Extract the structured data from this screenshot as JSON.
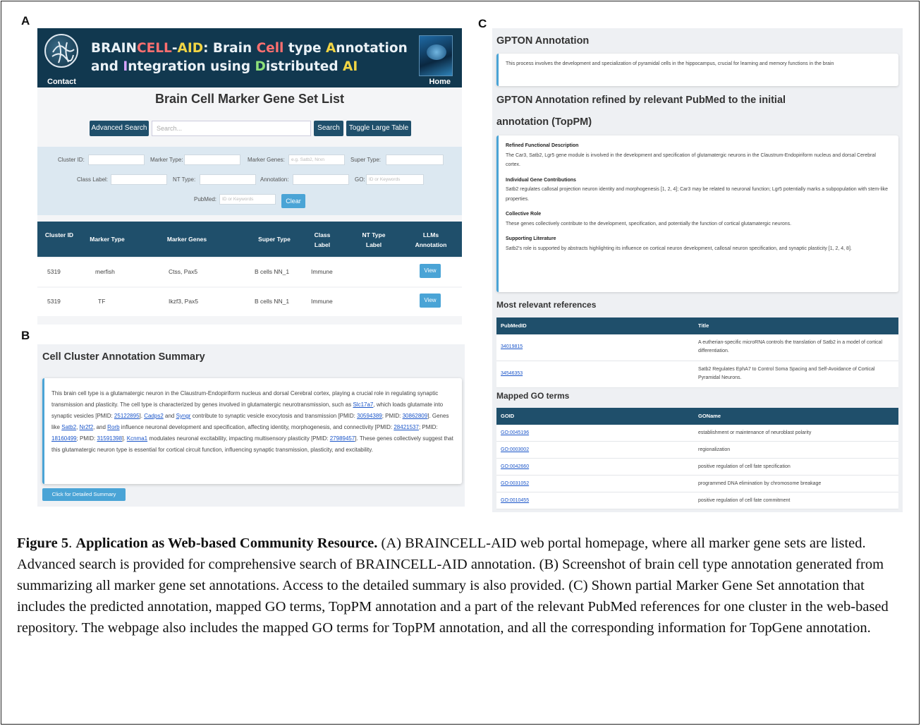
{
  "panel_letters": {
    "a": "A",
    "b": "B",
    "c": "C"
  },
  "panel_a": {
    "title_parts": [
      "BRAIN",
      "CELL",
      "-",
      "AID",
      ": Brain ",
      "Cell",
      " type ",
      "A",
      "nnotation",
      "and ",
      "I",
      "ntegration using ",
      "D",
      "istributed ",
      "AI"
    ],
    "contact": "Contact",
    "home": "Home",
    "heading": "Brain Cell Marker Gene Set List",
    "advanced_search": "Advanced Search",
    "search_placeholder": "Search...",
    "search_button": "Search",
    "toggle_button": "Toggle Large Table",
    "filters": {
      "cluster_id": "Cluster ID:",
      "marker_type": "Marker Type:",
      "marker_genes": "Marker Genes:",
      "marker_genes_ph": "e.g. Satb2, Nrxn",
      "super_type": "Super Type:",
      "class_label": "Class Label:",
      "nt_type": "NT Type:",
      "annotation": "Annotation:",
      "go": "GO:",
      "go_ph": "ID or Keywords",
      "pubmed": "PubMed:",
      "pubmed_ph": "ID or Keywords",
      "clear": "Clear"
    },
    "table_headers": [
      "Cluster ID",
      "Marker Type",
      "Marker Genes",
      "Super Type",
      "Class Label",
      "NT Type Label",
      "LLMs Annotation"
    ],
    "rows": [
      {
        "cluster": "5319",
        "type": "merfish",
        "genes": "Ctss, Pax5",
        "super": "B cells NN_1",
        "class": "Immune",
        "view": "View"
      },
      {
        "cluster": "5319",
        "type": "TF",
        "genes": "Ikzf3, Pax5",
        "super": "B cells NN_1",
        "class": "Immune",
        "view": "View"
      }
    ]
  },
  "panel_b": {
    "title": "Cell Cluster Annotation Summary",
    "text": {
      "t1": "This brain cell type is a glutamatergic neuron in the Claustrum-Endopiriform nucleus and dorsal Cerebral cortex, playing a crucial role in regulating synaptic transmission and plasticity. The cell type is characterized by genes involved in glutamatergic neurotransmission, such as ",
      "g1": "Slc17a7",
      "t2": ", which loads glutamate into synaptic vesicles [PMID: ",
      "p1": "25122895",
      "t3": "]. ",
      "g2": "Cadps2",
      "t4": " and ",
      "g3": "Syngr",
      "t5": " contribute to synaptic vesicle exocytosis and transmission [PMID: ",
      "p2": "30594389",
      "t6": "; PMID: ",
      "p3": "30862809",
      "t7": "]. Genes like ",
      "g4": "Satb2",
      "t8": ", ",
      "g5": "Nr2f2",
      "t9": ", and ",
      "g6": "Rorb",
      "t10": " influence neuronal development and specification, affecting identity, morphogenesis, and connectivity [PMID: ",
      "p4": "28421537",
      "t11": "; PMID: ",
      "p5": "18160499",
      "t12": "; PMID: ",
      "p6": "31591398",
      "t13": "]. ",
      "g7": "Kcnma1",
      "t14": " modulates neuronal excitability, impacting multisensory plasticity [PMID: ",
      "p7": "27989457",
      "t15": "]. These genes collectively suggest that this glutamatergic neuron type is essential for cortical circuit function, influencing synaptic transmission, plasticity, and excitability."
    },
    "button": "Click for Detailed Summary"
  },
  "panel_c": {
    "gpton_title": "GPTON Annotation",
    "gpton_text": "This process involves the development and specialization of pyramidal cells in the hippocampus, crucial for learning and memory functions in the brain",
    "refined_title_1": "GPTON Annotation refined by relevant PubMed to the initial",
    "refined_title_2": "annotation (TopPM)",
    "sections": [
      {
        "heading": "Refined Functional Description",
        "text": "The Car3, Satb2, Lgr5 gene module is involved in the development and specification of glutamatergic neurons in the Claustrum-Endopiriform nucleus and dorsal Cerebral cortex."
      },
      {
        "heading": "Individual Gene Contributions",
        "text": "Satb2 regulates callosal projection neuron identity and morphogenesis [1, 2, 4]; Car3 may be related to neuronal function; Lgr5 potentially marks a subpopulation with stem-like properties."
      },
      {
        "heading": "Collective Role",
        "text": "These genes collectively contribute to the development, specification, and potentially the function of cortical glutamatergic neurons."
      },
      {
        "heading": "Supporting Literature",
        "text": "Satb2's role is supported by abstracts highlighting its influence on cortical neuron development, callosal neuron specification, and synaptic plasticity [1, 2, 4, 8]."
      }
    ],
    "refs_title": "Most relevant references",
    "refs_headers": [
      "PubMedID",
      "Title"
    ],
    "refs": [
      {
        "id": "34019815",
        "title": "A eutherian-specific microRNA controls the translation of Satb2 in a model of cortical differentiation."
      },
      {
        "id": "34546353",
        "title": "Satb2 Regulates EphA7 to Control Soma Spacing and Self-Avoidance of Cortical Pyramidal Neurons."
      }
    ],
    "go_title": "Mapped GO terms",
    "go_headers": [
      "GOID",
      "GOName"
    ],
    "go_rows": [
      {
        "id": "GO:0045196",
        "name": "establishment or maintenance of neuroblast polarity"
      },
      {
        "id": "GO:0003002",
        "name": "regionalization"
      },
      {
        "id": "GO:0042660",
        "name": "positive regulation of cell fate specification"
      },
      {
        "id": "GO:0031052",
        "name": "programmed DNA elimination by chromosome breakage"
      },
      {
        "id": "GO:0010455",
        "name": "positive regulation of cell fate commitment"
      }
    ]
  },
  "caption": {
    "label": "Figure 5",
    "sep": ". ",
    "title": "Application as Web-based Community Resource.",
    "body": " (A) BRAINCELL-AID web portal homepage, where all marker gene sets are listed. Advanced search is provided for comprehensive search of BRAINCELL-AID annotation. (B) Screenshot of brain cell type annotation generated from summarizing all marker gene set annotations. Access to the detailed summary is also provided. (C) Shown partial Marker Gene Set annotation that includes the predicted annotation, mapped GO terms, TopPM annotation and a part of the relevant PubMed references for one cluster in the web-based repository. The webpage also includes the mapped GO terms for TopPM annotation, and all the corresponding information for TopGene annotation."
  }
}
